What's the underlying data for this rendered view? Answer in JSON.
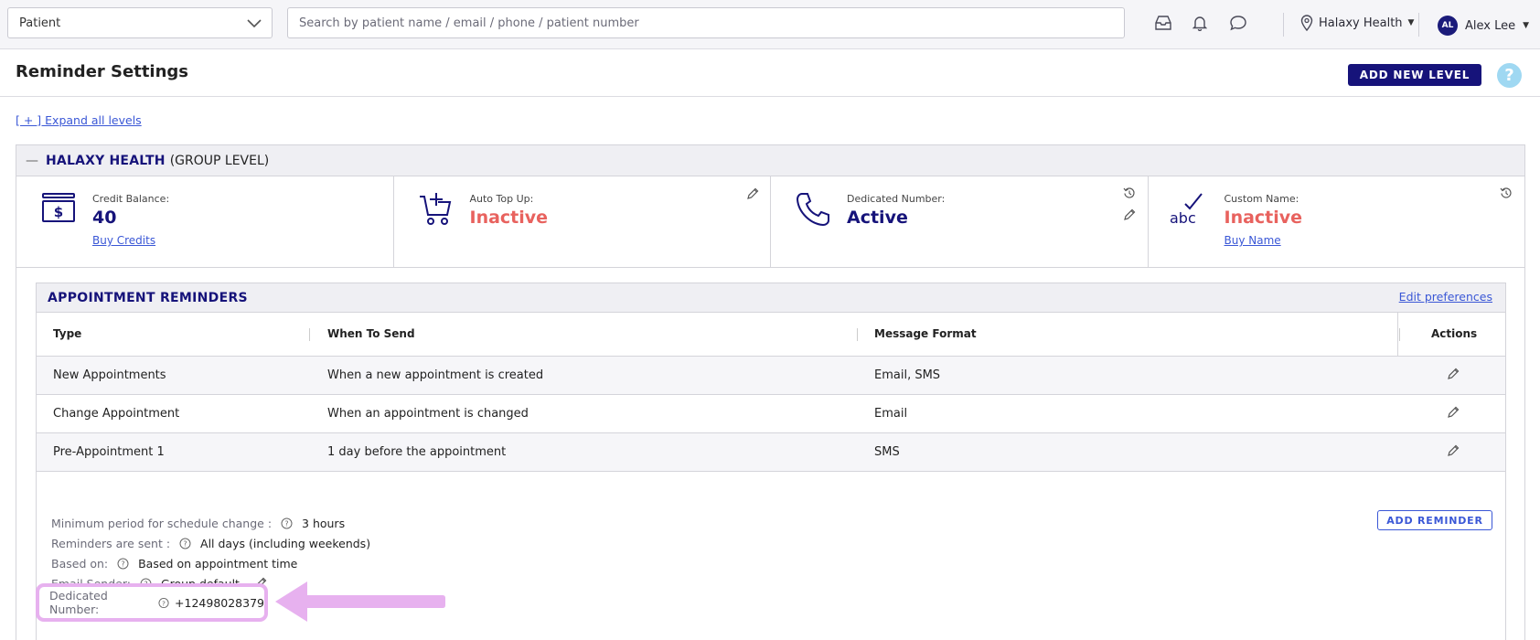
{
  "topbar": {
    "patient_select": "Patient",
    "search_placeholder": "Search by patient name / email / phone / patient number",
    "location": "Halaxy Health",
    "user_initials": "AL",
    "user_name": "Alex Lee"
  },
  "header": {
    "title": "Reminder Settings",
    "add_level_label": "ADD NEW LEVEL",
    "help_label": "?"
  },
  "expand_link": "[ + ] Expand all levels",
  "group": {
    "collapse_symbol": "—",
    "name": "HALAXY HEALTH",
    "level": "(GROUP LEVEL)",
    "cards": {
      "credit": {
        "label": "Credit Balance:",
        "value": "40",
        "link": "Buy Credits"
      },
      "topup": {
        "label": "Auto Top Up:",
        "value": "Inactive"
      },
      "dedicated": {
        "label": "Dedicated Number:",
        "value": "Active"
      },
      "custom": {
        "label": "Custom Name:",
        "value": "Inactive",
        "link": "Buy Name",
        "icon_text": "abc"
      }
    }
  },
  "reminders": {
    "title": "APPOINTMENT REMINDERS",
    "edit_link": "Edit preferences",
    "columns": [
      "Type",
      "When To Send",
      "Message Format",
      "Actions"
    ],
    "rows": [
      {
        "type": "New Appointments",
        "when": "When a new appointment is created",
        "format": "Email, SMS"
      },
      {
        "type": "Change Appointment",
        "when": "When an appointment is changed",
        "format": "Email"
      },
      {
        "type": "Pre-Appointment 1",
        "when": "1 day before the appointment",
        "format": "SMS"
      }
    ],
    "meta": {
      "min_period_label": "Minimum period for schedule change :",
      "min_period_value": "3 hours",
      "sent_label": "Reminders are sent :",
      "sent_value": "All days (including weekends)",
      "based_label": "Based on:",
      "based_value": "Based on appointment time",
      "sender_label": "Email Sender:",
      "sender_value": "Group default",
      "dedicated_label": "Dedicated Number:",
      "dedicated_value": "+12498028379"
    },
    "add_reminder_label": "ADD REMINDER"
  },
  "colors": {
    "brand_navy": "#16137a",
    "inactive_red": "#e8625e",
    "link_blue": "#3a57d6",
    "highlight_pink": "#e7b1ef"
  }
}
